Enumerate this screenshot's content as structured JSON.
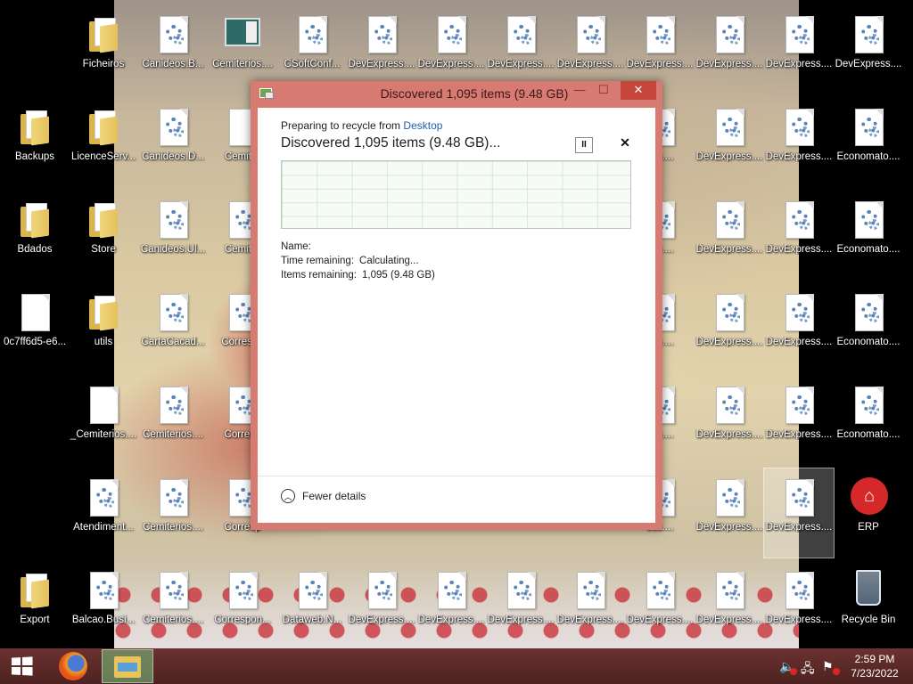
{
  "desktop": {
    "icons": [
      {
        "label": "Ficheiros",
        "type": "folder"
      },
      {
        "label": "Canideos.B...",
        "type": "config"
      },
      {
        "label": "Cemiterios....",
        "type": "screenshot"
      },
      {
        "label": "CSoftConf...",
        "type": "config"
      },
      {
        "label": "DevExpress....",
        "type": "config"
      },
      {
        "label": "DevExpress....",
        "type": "config"
      },
      {
        "label": "DevExpress....",
        "type": "config"
      },
      {
        "label": "DevExpress....",
        "type": "config"
      },
      {
        "label": "DevExpress....",
        "type": "config"
      },
      {
        "label": "DevExpress....",
        "type": "config"
      },
      {
        "label": "DevExpress....",
        "type": "config"
      },
      {
        "label": "DevExpress....",
        "type": "config"
      },
      {
        "label": "Backups",
        "type": "folder"
      },
      {
        "label": "LicenceServ...",
        "type": "folder"
      },
      {
        "label": "Canideos.D...",
        "type": "config"
      },
      {
        "label": "Cemiter",
        "type": "doc"
      },
      {
        "label": "ess....",
        "type": "config"
      },
      {
        "label": "DevExpress....",
        "type": "config"
      },
      {
        "label": "DevExpress....",
        "type": "config"
      },
      {
        "label": "Economato....",
        "type": "config"
      },
      {
        "label": "Bdados",
        "type": "folder"
      },
      {
        "label": "Store",
        "type": "folder"
      },
      {
        "label": "Canideos.Ul...",
        "type": "config"
      },
      {
        "label": "Cemiter",
        "type": "config"
      },
      {
        "label": "ess....",
        "type": "config"
      },
      {
        "label": "DevExpress....",
        "type": "config"
      },
      {
        "label": "DevExpress....",
        "type": "config"
      },
      {
        "label": "Economato....",
        "type": "config"
      },
      {
        "label": "0c7ff6d5-e6...",
        "type": "doc"
      },
      {
        "label": "utils",
        "type": "folder"
      },
      {
        "label": "CartaCacad...",
        "type": "config"
      },
      {
        "label": "Correspo",
        "type": "config"
      },
      {
        "label": "ess....",
        "type": "config"
      },
      {
        "label": "DevExpress....",
        "type": "config"
      },
      {
        "label": "DevExpress....",
        "type": "config"
      },
      {
        "label": "Economato....",
        "type": "config"
      },
      {
        "label": "_Cemiterios....",
        "type": "doc"
      },
      {
        "label": "Cemiterios....",
        "type": "config"
      },
      {
        "label": "Corresp",
        "type": "config"
      },
      {
        "label": "ess....",
        "type": "config"
      },
      {
        "label": "DevExpress....",
        "type": "config"
      },
      {
        "label": "DevExpress....",
        "type": "config"
      },
      {
        "label": "Economato....",
        "type": "config"
      },
      {
        "label": "Atendiment...",
        "type": "config"
      },
      {
        "label": "Cemiterios....",
        "type": "config"
      },
      {
        "label": "Corresp",
        "type": "config"
      },
      {
        "label": "ess....",
        "type": "config"
      },
      {
        "label": "DevExpress....",
        "type": "config"
      },
      {
        "label": "DevExpress....",
        "type": "config"
      },
      {
        "label": "ERP",
        "type": "erp"
      },
      {
        "label": "Export",
        "type": "folder"
      },
      {
        "label": "Balcao.Busi...",
        "type": "config"
      },
      {
        "label": "Cemiterios....",
        "type": "config"
      },
      {
        "label": "Correspon...",
        "type": "config"
      },
      {
        "label": "Dataweb.N...",
        "type": "config"
      },
      {
        "label": "DevExpress....",
        "type": "config"
      },
      {
        "label": "DevExpress....",
        "type": "config"
      },
      {
        "label": "DevExpress....",
        "type": "config"
      },
      {
        "label": "DevExpress....",
        "type": "config"
      },
      {
        "label": "DevExpress....",
        "type": "config"
      },
      {
        "label": "DevExpress....",
        "type": "config"
      },
      {
        "label": "DevExpress....",
        "type": "config"
      },
      {
        "label": "Recycle Bin",
        "type": "recycle-bin"
      }
    ]
  },
  "dialog": {
    "title": "Discovered 1,095 items (9.48 GB)",
    "preparing_prefix": "Preparing to recycle from",
    "preparing_location": "Desktop",
    "heading": "Discovered 1,095 items (9.48 GB)...",
    "pause_symbol": "II",
    "cancel_symbol": "✕",
    "name_label": "Name:",
    "name_value": "",
    "time_label": "Time remaining:",
    "time_value": "Calculating...",
    "items_label": "Items remaining:",
    "items_value": "1,095 (9.48 GB)",
    "fewer_details": "Fewer details",
    "window_controls": {
      "minimize": "—",
      "maximize": "☐",
      "close": "✕"
    }
  },
  "taskbar": {
    "time": "2:59 PM",
    "date": "7/23/2022"
  },
  "colors": {
    "dialog_frame": "#d77a72",
    "close_button": "#c7463c",
    "link": "#1b5faa",
    "taskbar": "#5a2a2a"
  }
}
